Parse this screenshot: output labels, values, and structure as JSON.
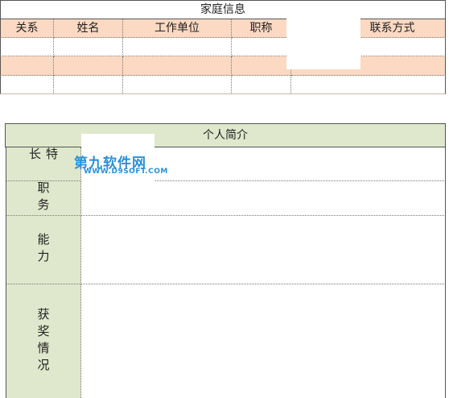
{
  "family": {
    "title": "家庭信息",
    "columns": [
      "关系",
      "姓名",
      "工作单位",
      "职称",
      "联系方式"
    ]
  },
  "profile": {
    "title": "个人简介",
    "rows": [
      {
        "label": "特长"
      },
      {
        "label": "职务"
      },
      {
        "label": "能力"
      },
      {
        "label": "获奖情况"
      }
    ]
  },
  "watermark": {
    "brand": "第九软件网",
    "url": "WWW.D9SOFT.COM"
  },
  "colors": {
    "header_peach": "#fbd9c2",
    "label_green": "#dfe8cc",
    "watermark_blue": "#2b8fd6"
  }
}
